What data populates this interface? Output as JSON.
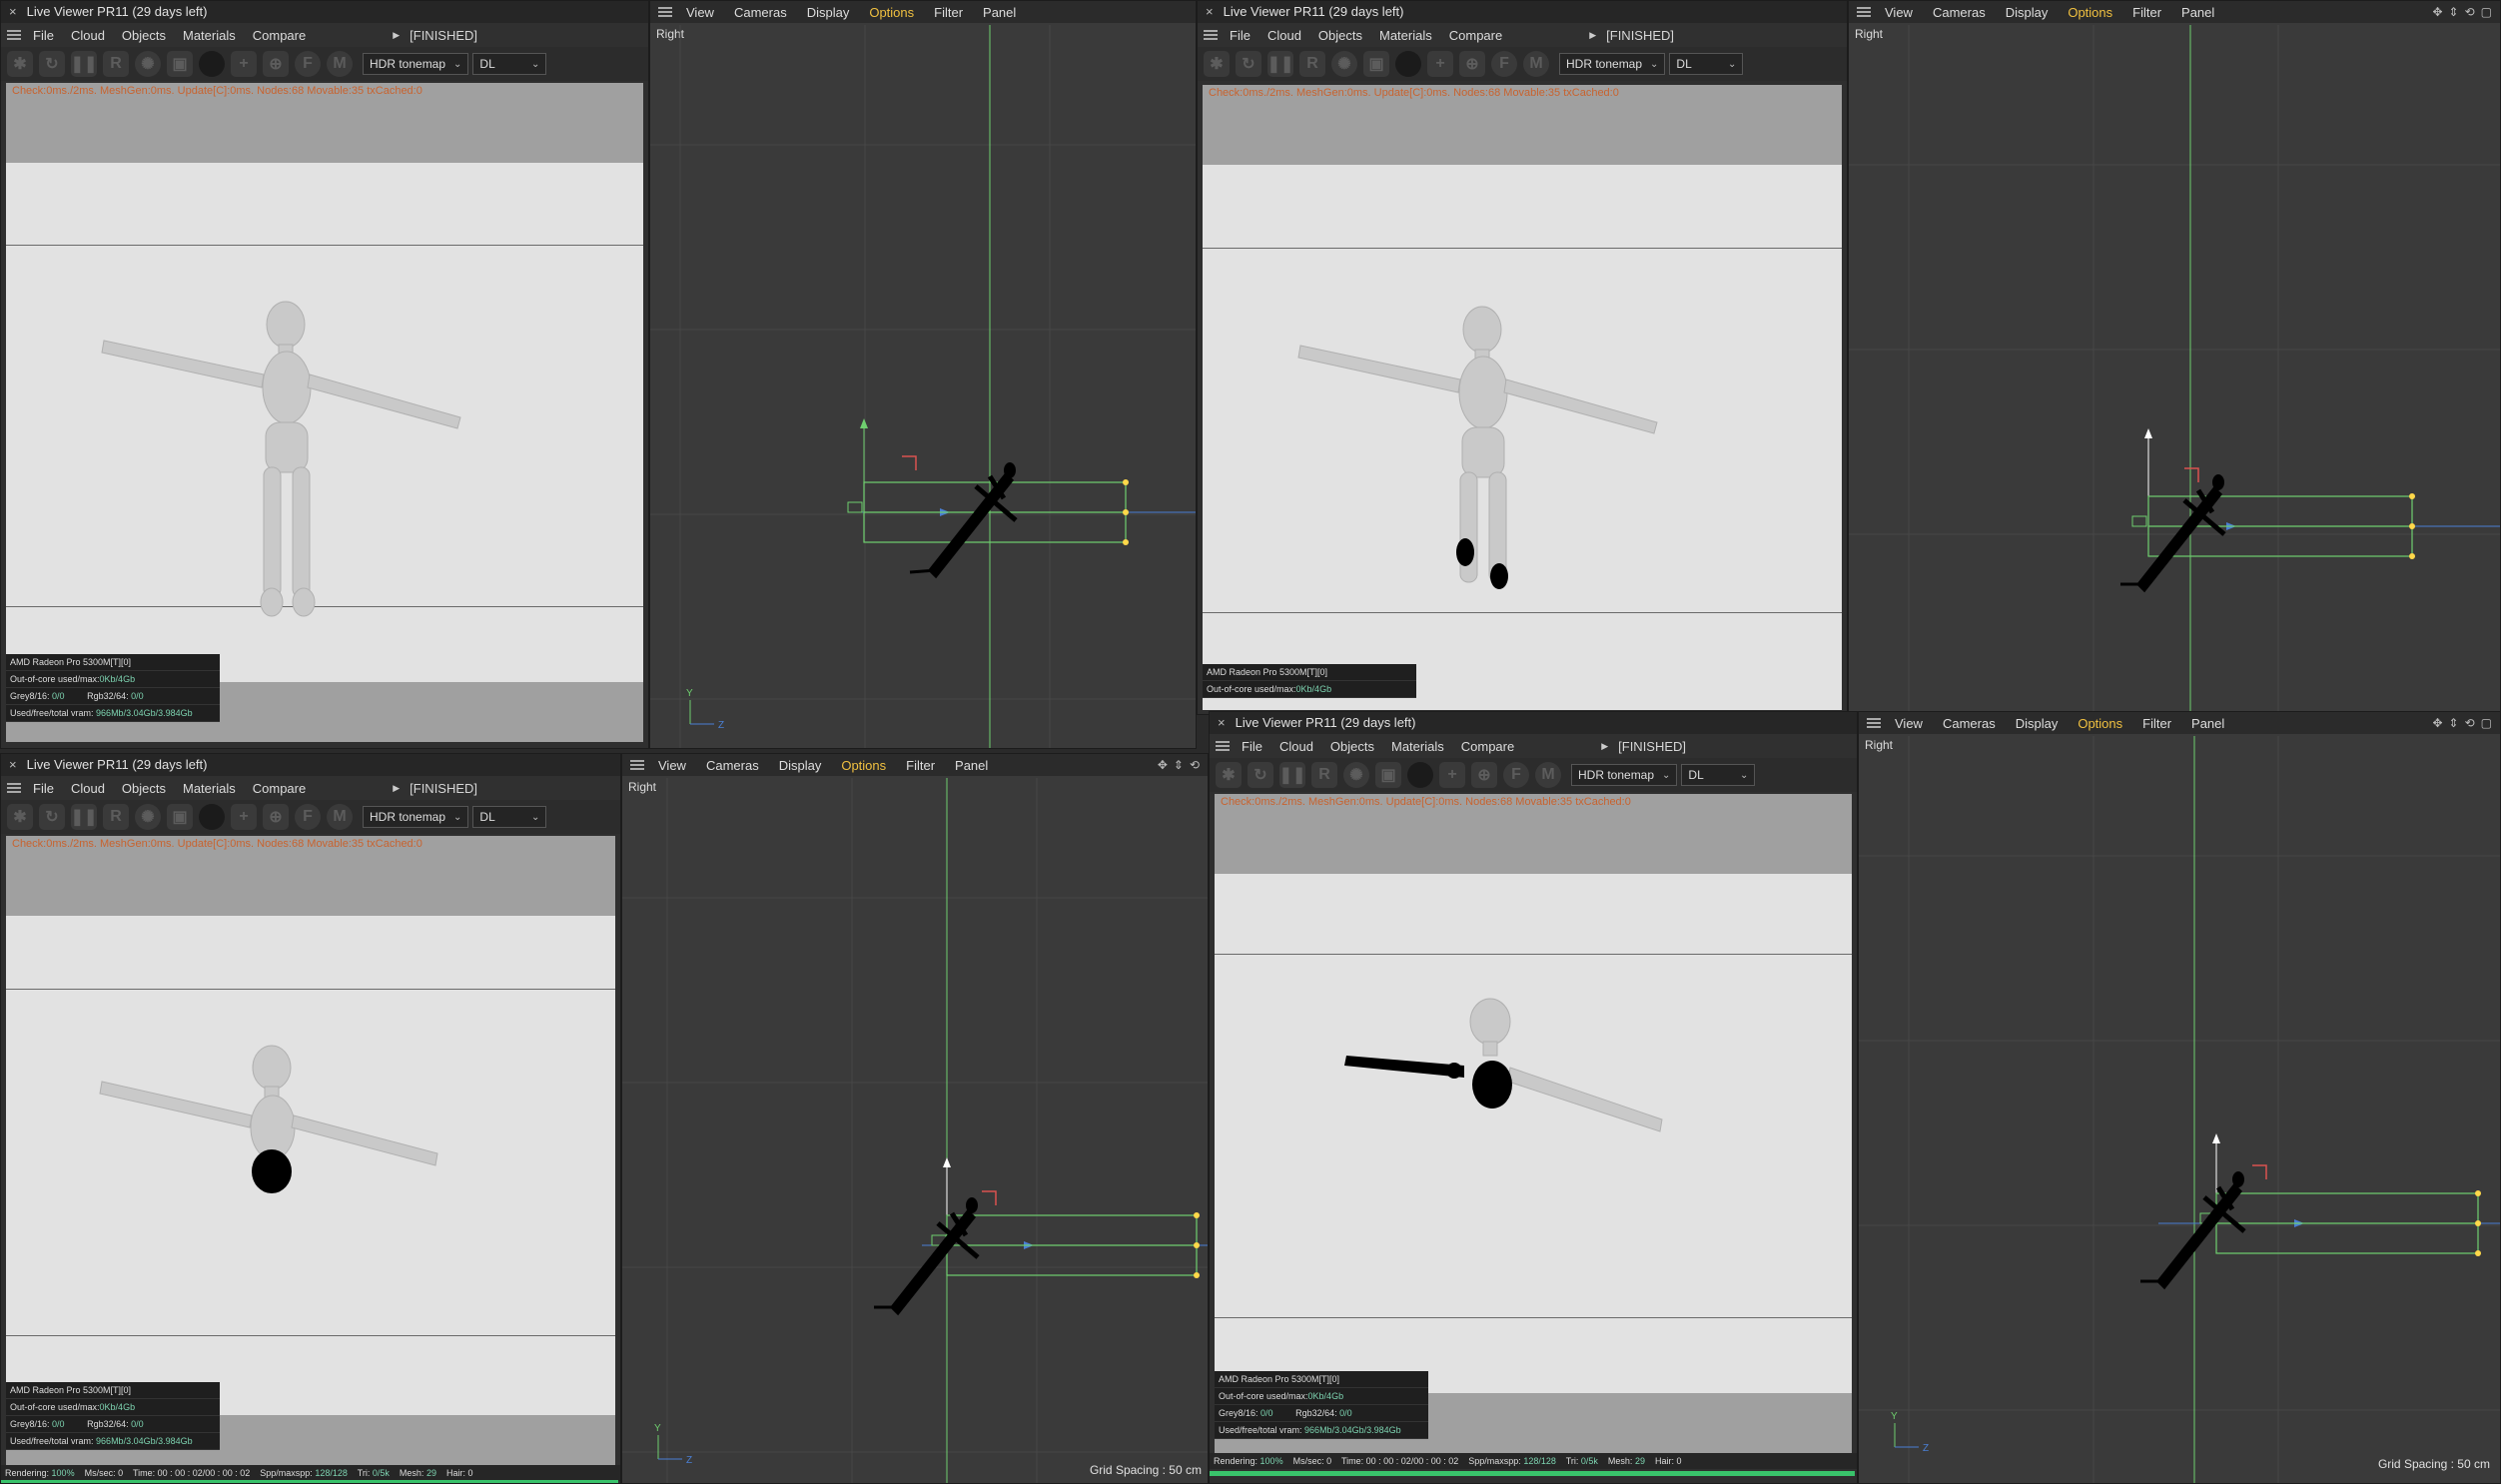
{
  "live_viewer": {
    "title": "Live Viewer PR11 (29 days left)",
    "close": "×",
    "menu": [
      "File",
      "Cloud",
      "Objects",
      "Materials",
      "Compare"
    ],
    "status": "[FINISHED]",
    "tonemap": "HDR tonemap",
    "kernel": "DL",
    "stats": "Check:0ms./2ms. MeshGen:0ms. Update[C]:0ms. Nodes:68 Movable:35 txCached:0",
    "info": {
      "gpu": "AMD Radeon Pro 5300M[T][0]",
      "ooc_label": "Out-of-core used/max:",
      "ooc_value": "0Kb/4Gb",
      "grey_label": "Grey8/16:",
      "grey_value": "0/0",
      "rgb_label": "Rgb32/64:",
      "rgb_value": "0/0",
      "vram_label": "Used/free/total vram:",
      "vram_value": "966Mb/3.04Gb/3.984Gb"
    },
    "render_status": {
      "rendering_label": "Rendering:",
      "rendering_value": "100%",
      "mssec_label": "Ms/sec:",
      "mssec_value": "0",
      "time_label": "Time:",
      "time_value": "00 : 00 : 02/00 : 00 : 02",
      "spp_label": "Spp/maxspp:",
      "spp_value": "128/128",
      "tri_label": "Tri:",
      "tri_value": "0/5k",
      "mesh_label": "Mesh:",
      "mesh_value": "29",
      "hair_label": "Hair:",
      "hair_value": "0"
    }
  },
  "viewport": {
    "menu": [
      "View",
      "Cameras",
      "Display",
      "Options",
      "Filter",
      "Panel"
    ],
    "active_menu": "Options",
    "label": "Right",
    "grid_spacing": "Grid Spacing : 50 cm",
    "axis_y": "Y",
    "axis_z": "Z"
  },
  "colors": {
    "accent": "#f0c040",
    "stats_text": "#c8632f",
    "grid_green": "#6fcf6f",
    "axis_blue": "#4a7fd4",
    "progress_green": "#39c36b"
  }
}
